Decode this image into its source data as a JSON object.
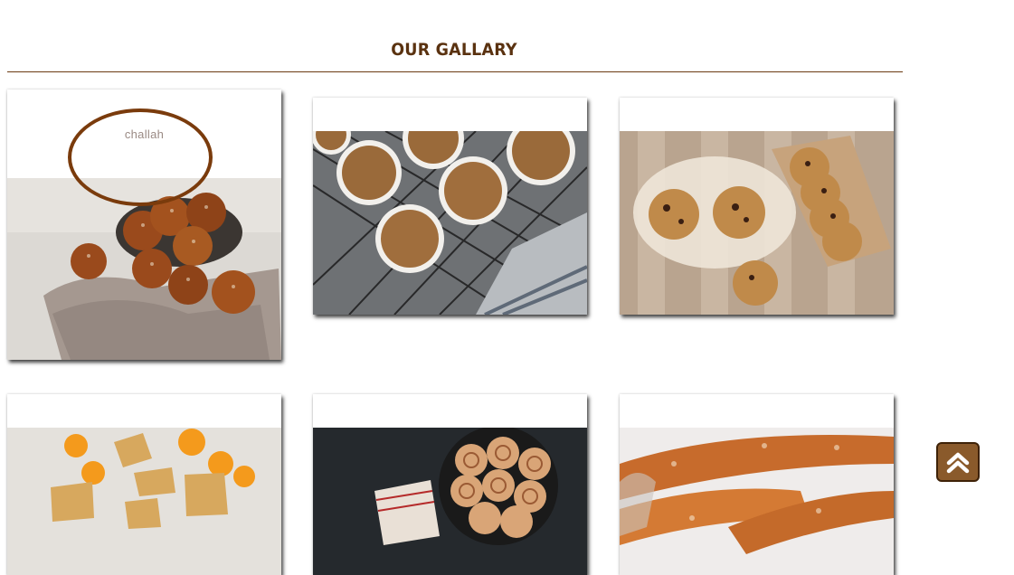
{
  "gallery": {
    "title": "OUR GALLARY",
    "items": [
      {
        "caption": "challah",
        "subject": "braided challah rolls",
        "highlighted": true
      },
      {
        "caption": "",
        "subject": "muffins on cooling rack"
      },
      {
        "caption": "",
        "subject": "chocolate chip cookies"
      },
      {
        "caption": "",
        "subject": "orange cake slices"
      },
      {
        "caption": "",
        "subject": "cinnamon rolls in pan"
      },
      {
        "caption": "",
        "subject": "baguettes"
      }
    ]
  },
  "scroll_top_button": {
    "icon": "double-chevron-up-icon"
  },
  "colors": {
    "brand_brown": "#5a3210",
    "button_bg": "#8a5a2b",
    "ring": "#7a3b0c"
  }
}
